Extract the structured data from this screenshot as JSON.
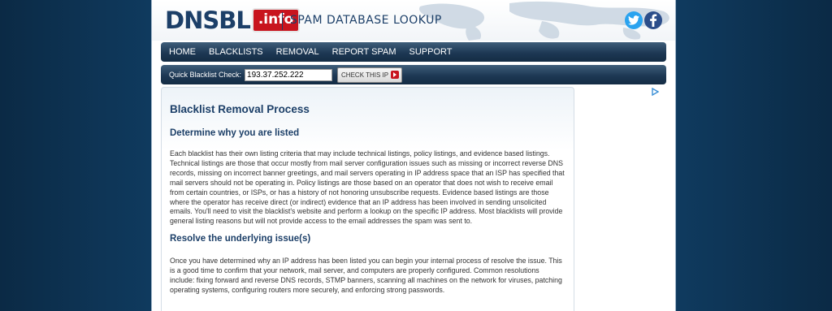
{
  "header": {
    "logo_text": "DNSBL",
    "logo_badge": ".info",
    "tagline": "SPAM DATABASE LOOKUP",
    "social_icons": [
      "twitter-icon",
      "facebook-icon"
    ]
  },
  "nav": {
    "items": [
      "HOME",
      "BLACKLISTS",
      "REMOVAL",
      "REPORT SPAM",
      "SUPPORT"
    ]
  },
  "quick_check": {
    "label": "Quick Blacklist Check:",
    "value": "193.37.252.222",
    "button_label": "CHECK THIS IP"
  },
  "article": {
    "title": "Blacklist Removal Process",
    "section1_heading": "Determine why you are listed",
    "section1_text": "Each blacklist has their own listing criteria that may include technical listings, policy listings, and evidence based listings. Technical listings are those that occur mostly from mail server configuration issues such as missing or incorrect reverse DNS records, missing on incorrect banner greetings, and mail servers operating in IP address space that an ISP has specified that mail servers should not be operating in. Policy listings are those based on an operator that does not wish to receive email from certain countries, or ISPs, or has a history of not honoring unsubscribe requests. Evidence based listings are those where the operator has receive direct (or indirect) evidence that an IP address has been involved in sending unsolicited emails. You'll need to visit the blacklist's website and perform a lookup on the specific IP address. Most blacklists will provide general listing reasons but will not provide access to the email addresses the spam was sent to.",
    "section2_heading": "Resolve the underlying issue(s)",
    "section2_text": "Once you have determined why an IP address has been listed you can begin your internal process of resolve the issue. This is a good time to confirm that your network, mail server, and computers are properly configured. Common resolutions include: fixing forward and reverse DNS records, STMP banners, scanning all machines on the network for viruses, patching operating systems, configuring routers more securely, and enforcing strong passwords."
  },
  "colors": {
    "brand_navy": "#1c3f68",
    "brand_red": "#c8141e",
    "page_background": "#0f3a5e"
  }
}
